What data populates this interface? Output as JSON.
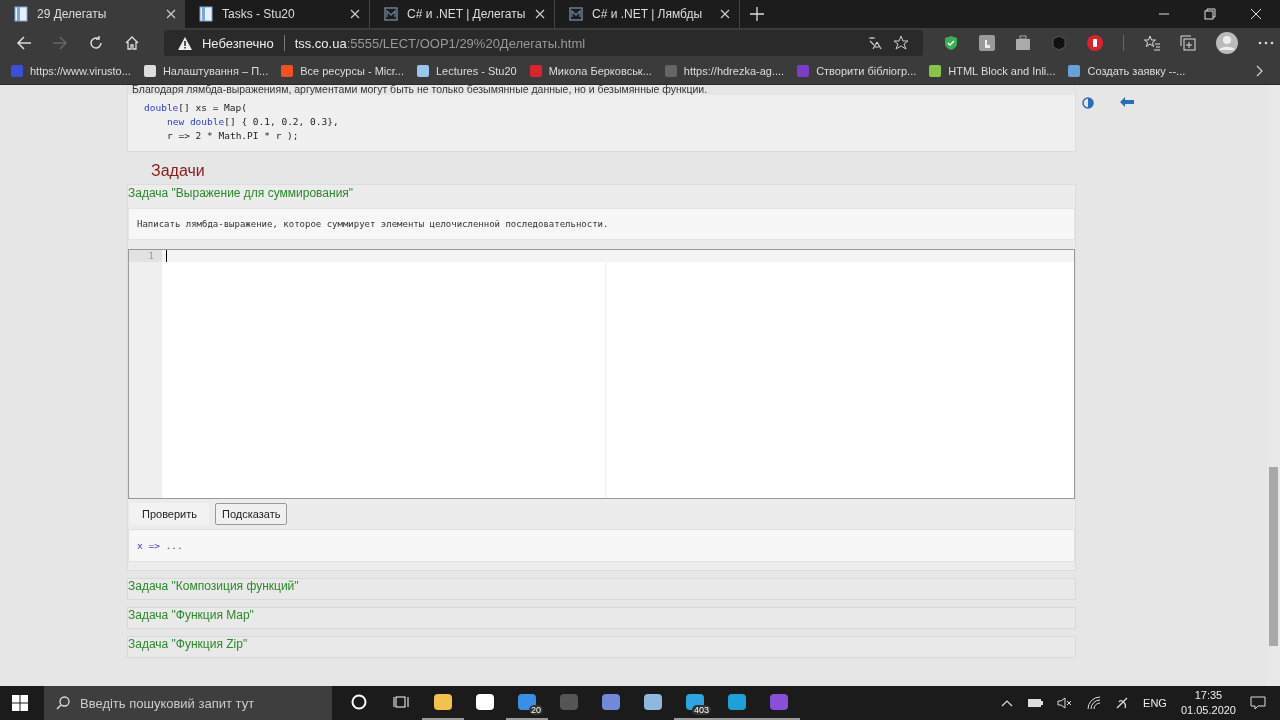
{
  "tabs": [
    {
      "title": "29 Делегаты",
      "selected": true
    },
    {
      "title": "Tasks - Stu20",
      "selected": false
    },
    {
      "title": "C# и .NET | Делегаты",
      "selected": false
    },
    {
      "title": "C# и .NET | Лямбды",
      "selected": false
    }
  ],
  "address": {
    "security": "Небезпечно",
    "host": "tss.co.ua",
    "path": ":5555/LECT/OOP1/29%20Делегаты.html"
  },
  "bookmarks": [
    "https://www.virusto...",
    "Налаштування – П...",
    "Все ресурсы - Micr...",
    "Lectures - Stu20",
    "Микола Берковськ...",
    "https://hdrezka-ag....",
    "Створити бібліогр...",
    "HTML Block and Inli...",
    "Создать заявку --..."
  ],
  "intro": "Благодаря лямбда-выражениям, аргументами могут быть не только безымянные данные, но и безымянные функции.",
  "example_code": [
    [
      {
        "text": "double",
        "kind": "keyword"
      },
      {
        "text": "[] xs = Map(",
        "kind": "plain"
      }
    ],
    [
      {
        "text": "new ",
        "kind": "keyword"
      },
      {
        "text": "double",
        "kind": "keyword"
      },
      {
        "text": "[] { 0.1, 0.2, 0.3},",
        "kind": "plain"
      }
    ],
    [
      {
        "text": "r => 2 * Math.PI * r );",
        "kind": "plain"
      }
    ]
  ],
  "section_title": "Задачи",
  "task": {
    "title": "Задача \"Выражение для суммирования\"",
    "description": "Написать лямбда-выражение, которое суммирует элементы целочисленной последовательности.",
    "line_number": "1",
    "buttons": [
      {
        "label": "Проверить",
        "kind": "flat"
      },
      {
        "label": "Подсказать",
        "kind": "outlined"
      }
    ],
    "hint": "x => ..."
  },
  "other_tasks": [
    "Задача \"Композиция функций\"",
    "Задача \"Функция Map\"",
    "Задача \"Функция Zip\""
  ],
  "taskbar": {
    "search_placeholder": "Введіть пошуковий запит тут",
    "apps": [
      {
        "active": false
      },
      {
        "active": false
      },
      {
        "active": true
      },
      {
        "active": false
      },
      {
        "active": true,
        "badge": "20"
      },
      {
        "active": false
      },
      {
        "active": false
      },
      {
        "active": false
      },
      {
        "active": true,
        "badge": "403"
      },
      {
        "active": true
      },
      {
        "active": true
      }
    ],
    "language": "ENG",
    "time": "17:35",
    "date": "01.05.2020"
  }
}
